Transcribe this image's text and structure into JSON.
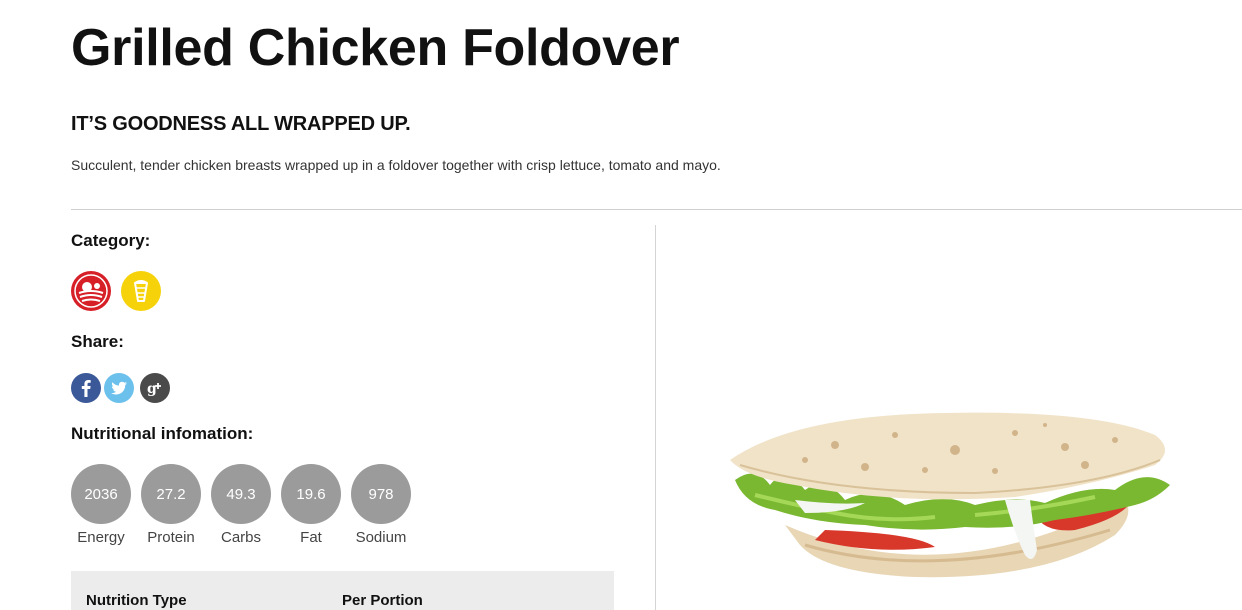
{
  "product": {
    "title": "Grilled Chicken Foldover",
    "tagline": "IT’S GOODNESS ALL WRAPPED UP.",
    "description": "Succulent, tender chicken breasts wrapped up in a foldover together with crisp lettuce, tomato and mayo."
  },
  "category": {
    "label": "Category:",
    "icons": [
      {
        "name": "farm-fresh-icon",
        "color": "#d61f26"
      },
      {
        "name": "wrap-icon",
        "color": "#f6d20a"
      }
    ]
  },
  "share": {
    "label": "Share:",
    "icons": [
      {
        "name": "facebook-icon",
        "color": "#3b5998"
      },
      {
        "name": "twitter-icon",
        "color": "#6cc0ec"
      },
      {
        "name": "google-plus-icon",
        "color": "#4a4a4a"
      }
    ]
  },
  "nutrition": {
    "label": "Nutritional infomation:",
    "items": [
      {
        "value": "2036",
        "label": "Energy"
      },
      {
        "value": "27.2",
        "label": "Protein"
      },
      {
        "value": "49.3",
        "label": "Carbs"
      },
      {
        "value": "19.6",
        "label": "Fat"
      },
      {
        "value": "978",
        "label": "Sodium"
      }
    ],
    "table": {
      "col1": "Nutrition Type",
      "col2": "Per Portion"
    }
  }
}
